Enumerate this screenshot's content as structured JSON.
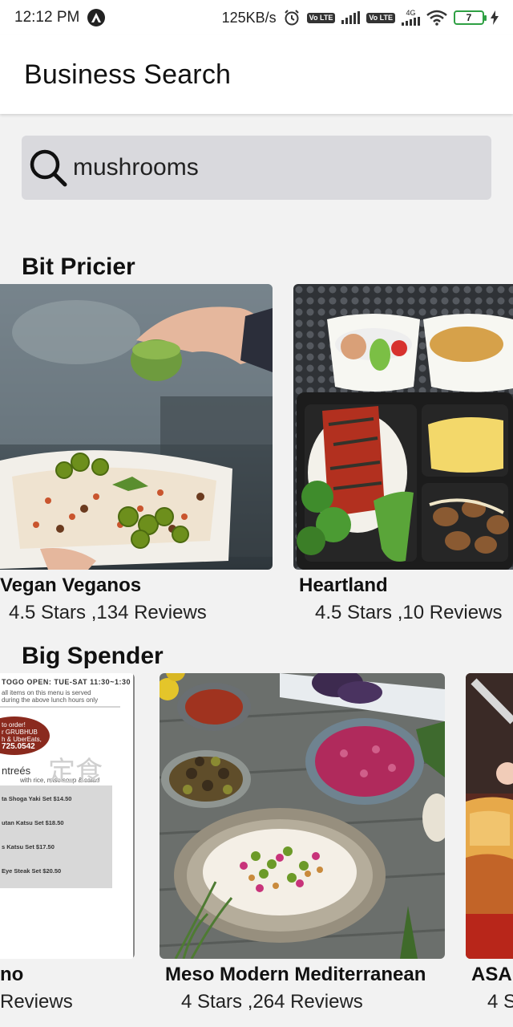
{
  "status_bar": {
    "time": "12:12 PM",
    "speed": "125KB/s",
    "battery": "7",
    "volte_1": "Vo LTE",
    "volte_2": "Vo LTE",
    "network_type": "4G",
    "icons": [
      "app-notification-icon",
      "alarm-icon",
      "volte-icon",
      "signal-icon",
      "wifi-icon",
      "battery-icon",
      "charging-icon"
    ]
  },
  "header": {
    "title": "Business Search"
  },
  "search": {
    "value": "mushrooms",
    "icon": "search-icon"
  },
  "sections": [
    {
      "title": "Bit Pricier",
      "cards": [
        {
          "name": "Vegan Veganos",
          "meta": "4.5 Stars ,134 Reviews"
        },
        {
          "name": "Heartland",
          "meta": "4.5 Stars ,10 Reviews"
        }
      ]
    },
    {
      "title": "Big Spender",
      "cards": [
        {
          "name": "no",
          "meta": "Reviews"
        },
        {
          "name": "Meso Modern Mediterranean",
          "meta": "4 Stars ,264 Reviews"
        },
        {
          "name": "ASA",
          "meta": "4 S"
        }
      ]
    }
  ],
  "menu_image_text": {
    "header": "TOGO OPEN: TUE-SAT 11:30~1:30",
    "note_1": "all items on this menu is served",
    "note_2": "during the above lunch hours only",
    "order_1": "to order!",
    "order_2": "r GRUBHUB",
    "order_3": "h & UberEats,",
    "phone": "725.0542",
    "entrees": "ntreés",
    "entrees_sub": "with rice, miso soup & salad",
    "kanji": "定食",
    "items": [
      "ta Shoga Yaki Set $14.50",
      "utan Katsu Set $18.50",
      "s Katsu Set $17.50",
      "Eye Steak Set $20.50"
    ]
  },
  "colors": {
    "background": "#f2f2f2",
    "header_bg": "#ffffff",
    "search_bg": "#d9d9dd",
    "battery_green": "#2ea043"
  }
}
